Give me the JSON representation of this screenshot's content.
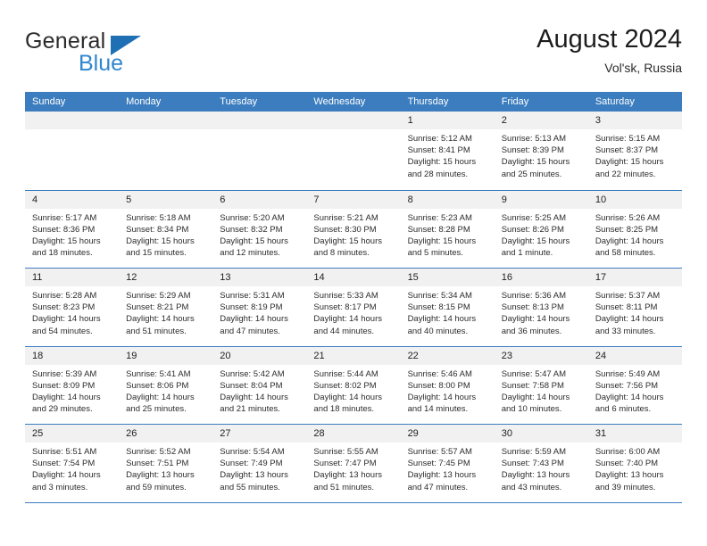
{
  "brand": {
    "name_top": "General",
    "name_bottom": "Blue",
    "triangle_color": "#1f6fb5",
    "blue_color": "#2f86d0"
  },
  "header": {
    "title": "August 2024",
    "subtitle": "Vol'sk, Russia"
  },
  "colors": {
    "header_blue": "#3c7dbf",
    "day_band": "#f1f1f1",
    "text": "#222222"
  },
  "weekdays": [
    "Sunday",
    "Monday",
    "Tuesday",
    "Wednesday",
    "Thursday",
    "Friday",
    "Saturday"
  ],
  "weeks": [
    [
      {
        "day": "",
        "sunrise": "",
        "sunset": "",
        "daylight_1": "",
        "daylight_2": ""
      },
      {
        "day": "",
        "sunrise": "",
        "sunset": "",
        "daylight_1": "",
        "daylight_2": ""
      },
      {
        "day": "",
        "sunrise": "",
        "sunset": "",
        "daylight_1": "",
        "daylight_2": ""
      },
      {
        "day": "",
        "sunrise": "",
        "sunset": "",
        "daylight_1": "",
        "daylight_2": ""
      },
      {
        "day": "1",
        "sunrise": "Sunrise: 5:12 AM",
        "sunset": "Sunset: 8:41 PM",
        "daylight_1": "Daylight: 15 hours",
        "daylight_2": "and 28 minutes."
      },
      {
        "day": "2",
        "sunrise": "Sunrise: 5:13 AM",
        "sunset": "Sunset: 8:39 PM",
        "daylight_1": "Daylight: 15 hours",
        "daylight_2": "and 25 minutes."
      },
      {
        "day": "3",
        "sunrise": "Sunrise: 5:15 AM",
        "sunset": "Sunset: 8:37 PM",
        "daylight_1": "Daylight: 15 hours",
        "daylight_2": "and 22 minutes."
      }
    ],
    [
      {
        "day": "4",
        "sunrise": "Sunrise: 5:17 AM",
        "sunset": "Sunset: 8:36 PM",
        "daylight_1": "Daylight: 15 hours",
        "daylight_2": "and 18 minutes."
      },
      {
        "day": "5",
        "sunrise": "Sunrise: 5:18 AM",
        "sunset": "Sunset: 8:34 PM",
        "daylight_1": "Daylight: 15 hours",
        "daylight_2": "and 15 minutes."
      },
      {
        "day": "6",
        "sunrise": "Sunrise: 5:20 AM",
        "sunset": "Sunset: 8:32 PM",
        "daylight_1": "Daylight: 15 hours",
        "daylight_2": "and 12 minutes."
      },
      {
        "day": "7",
        "sunrise": "Sunrise: 5:21 AM",
        "sunset": "Sunset: 8:30 PM",
        "daylight_1": "Daylight: 15 hours",
        "daylight_2": "and 8 minutes."
      },
      {
        "day": "8",
        "sunrise": "Sunrise: 5:23 AM",
        "sunset": "Sunset: 8:28 PM",
        "daylight_1": "Daylight: 15 hours",
        "daylight_2": "and 5 minutes."
      },
      {
        "day": "9",
        "sunrise": "Sunrise: 5:25 AM",
        "sunset": "Sunset: 8:26 PM",
        "daylight_1": "Daylight: 15 hours",
        "daylight_2": "and 1 minute."
      },
      {
        "day": "10",
        "sunrise": "Sunrise: 5:26 AM",
        "sunset": "Sunset: 8:25 PM",
        "daylight_1": "Daylight: 14 hours",
        "daylight_2": "and 58 minutes."
      }
    ],
    [
      {
        "day": "11",
        "sunrise": "Sunrise: 5:28 AM",
        "sunset": "Sunset: 8:23 PM",
        "daylight_1": "Daylight: 14 hours",
        "daylight_2": "and 54 minutes."
      },
      {
        "day": "12",
        "sunrise": "Sunrise: 5:29 AM",
        "sunset": "Sunset: 8:21 PM",
        "daylight_1": "Daylight: 14 hours",
        "daylight_2": "and 51 minutes."
      },
      {
        "day": "13",
        "sunrise": "Sunrise: 5:31 AM",
        "sunset": "Sunset: 8:19 PM",
        "daylight_1": "Daylight: 14 hours",
        "daylight_2": "and 47 minutes."
      },
      {
        "day": "14",
        "sunrise": "Sunrise: 5:33 AM",
        "sunset": "Sunset: 8:17 PM",
        "daylight_1": "Daylight: 14 hours",
        "daylight_2": "and 44 minutes."
      },
      {
        "day": "15",
        "sunrise": "Sunrise: 5:34 AM",
        "sunset": "Sunset: 8:15 PM",
        "daylight_1": "Daylight: 14 hours",
        "daylight_2": "and 40 minutes."
      },
      {
        "day": "16",
        "sunrise": "Sunrise: 5:36 AM",
        "sunset": "Sunset: 8:13 PM",
        "daylight_1": "Daylight: 14 hours",
        "daylight_2": "and 36 minutes."
      },
      {
        "day": "17",
        "sunrise": "Sunrise: 5:37 AM",
        "sunset": "Sunset: 8:11 PM",
        "daylight_1": "Daylight: 14 hours",
        "daylight_2": "and 33 minutes."
      }
    ],
    [
      {
        "day": "18",
        "sunrise": "Sunrise: 5:39 AM",
        "sunset": "Sunset: 8:09 PM",
        "daylight_1": "Daylight: 14 hours",
        "daylight_2": "and 29 minutes."
      },
      {
        "day": "19",
        "sunrise": "Sunrise: 5:41 AM",
        "sunset": "Sunset: 8:06 PM",
        "daylight_1": "Daylight: 14 hours",
        "daylight_2": "and 25 minutes."
      },
      {
        "day": "20",
        "sunrise": "Sunrise: 5:42 AM",
        "sunset": "Sunset: 8:04 PM",
        "daylight_1": "Daylight: 14 hours",
        "daylight_2": "and 21 minutes."
      },
      {
        "day": "21",
        "sunrise": "Sunrise: 5:44 AM",
        "sunset": "Sunset: 8:02 PM",
        "daylight_1": "Daylight: 14 hours",
        "daylight_2": "and 18 minutes."
      },
      {
        "day": "22",
        "sunrise": "Sunrise: 5:46 AM",
        "sunset": "Sunset: 8:00 PM",
        "daylight_1": "Daylight: 14 hours",
        "daylight_2": "and 14 minutes."
      },
      {
        "day": "23",
        "sunrise": "Sunrise: 5:47 AM",
        "sunset": "Sunset: 7:58 PM",
        "daylight_1": "Daylight: 14 hours",
        "daylight_2": "and 10 minutes."
      },
      {
        "day": "24",
        "sunrise": "Sunrise: 5:49 AM",
        "sunset": "Sunset: 7:56 PM",
        "daylight_1": "Daylight: 14 hours",
        "daylight_2": "and 6 minutes."
      }
    ],
    [
      {
        "day": "25",
        "sunrise": "Sunrise: 5:51 AM",
        "sunset": "Sunset: 7:54 PM",
        "daylight_1": "Daylight: 14 hours",
        "daylight_2": "and 3 minutes."
      },
      {
        "day": "26",
        "sunrise": "Sunrise: 5:52 AM",
        "sunset": "Sunset: 7:51 PM",
        "daylight_1": "Daylight: 13 hours",
        "daylight_2": "and 59 minutes."
      },
      {
        "day": "27",
        "sunrise": "Sunrise: 5:54 AM",
        "sunset": "Sunset: 7:49 PM",
        "daylight_1": "Daylight: 13 hours",
        "daylight_2": "and 55 minutes."
      },
      {
        "day": "28",
        "sunrise": "Sunrise: 5:55 AM",
        "sunset": "Sunset: 7:47 PM",
        "daylight_1": "Daylight: 13 hours",
        "daylight_2": "and 51 minutes."
      },
      {
        "day": "29",
        "sunrise": "Sunrise: 5:57 AM",
        "sunset": "Sunset: 7:45 PM",
        "daylight_1": "Daylight: 13 hours",
        "daylight_2": "and 47 minutes."
      },
      {
        "day": "30",
        "sunrise": "Sunrise: 5:59 AM",
        "sunset": "Sunset: 7:43 PM",
        "daylight_1": "Daylight: 13 hours",
        "daylight_2": "and 43 minutes."
      },
      {
        "day": "31",
        "sunrise": "Sunrise: 6:00 AM",
        "sunset": "Sunset: 7:40 PM",
        "daylight_1": "Daylight: 13 hours",
        "daylight_2": "and 39 minutes."
      }
    ]
  ]
}
